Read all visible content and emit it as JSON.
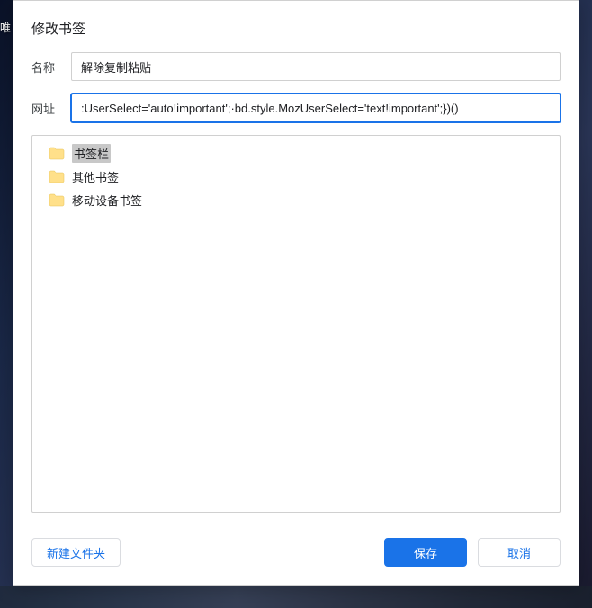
{
  "background": {
    "partial_text": "唯"
  },
  "dialog": {
    "title": "修改书签",
    "name_label": "名称",
    "name_value": "解除复制粘贴",
    "url_label": "网址",
    "url_value": ":UserSelect='auto!important';·bd.style.MozUserSelect='text!important';})()"
  },
  "folders": [
    {
      "label": "书签栏",
      "selected": true
    },
    {
      "label": "其他书签",
      "selected": false
    },
    {
      "label": "移动设备书签",
      "selected": false
    }
  ],
  "buttons": {
    "new_folder": "新建文件夹",
    "save": "保存",
    "cancel": "取消"
  }
}
